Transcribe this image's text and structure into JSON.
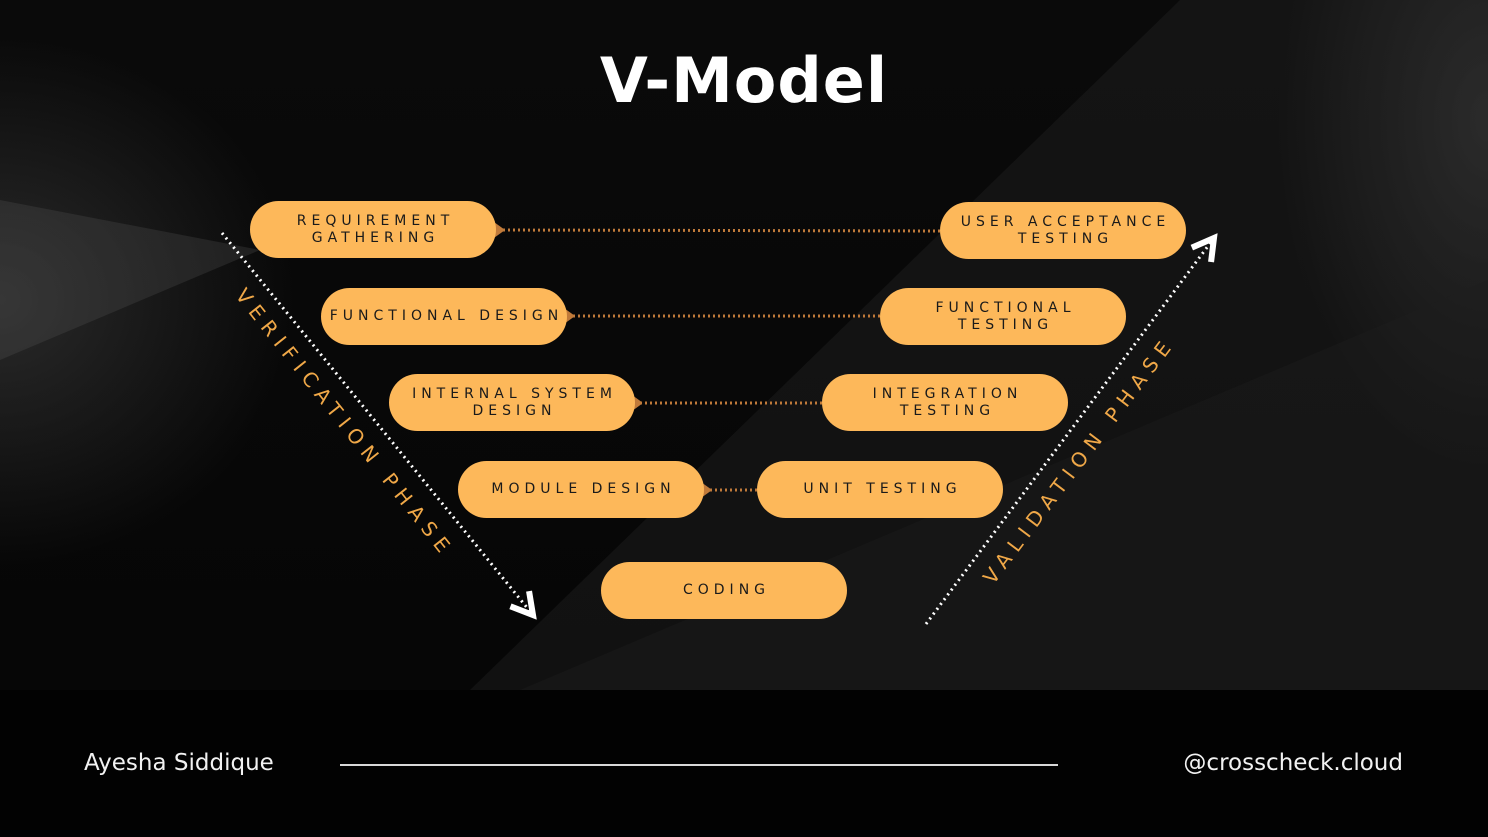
{
  "title": "V-Model",
  "verification_phases": [
    {
      "label": "REQUIREMENT GATHERING"
    },
    {
      "label": "FUNCTIONAL DESIGN"
    },
    {
      "label": "INTERNAL SYSTEM DESIGN"
    },
    {
      "label": "MODULE DESIGN"
    }
  ],
  "coding": {
    "label": "CODING"
  },
  "validation_phases": [
    {
      "label": "USER ACCEPTANCE TESTING"
    },
    {
      "label": "FUNCTIONAL TESTING"
    },
    {
      "label": "INTEGRATION TESTING"
    },
    {
      "label": "UNIT TESTING"
    }
  ],
  "phase_labels": {
    "left": "VERIFICATION PHASE",
    "right": "VALIDATION PHASE"
  },
  "footer": {
    "author": "Ayesha Siddique",
    "handle": "@crosscheck.cloud"
  },
  "colors": {
    "pill": "#fdb85a",
    "phase_text": "#f0a848",
    "connector": "#c07a3a",
    "background": "#000000"
  }
}
